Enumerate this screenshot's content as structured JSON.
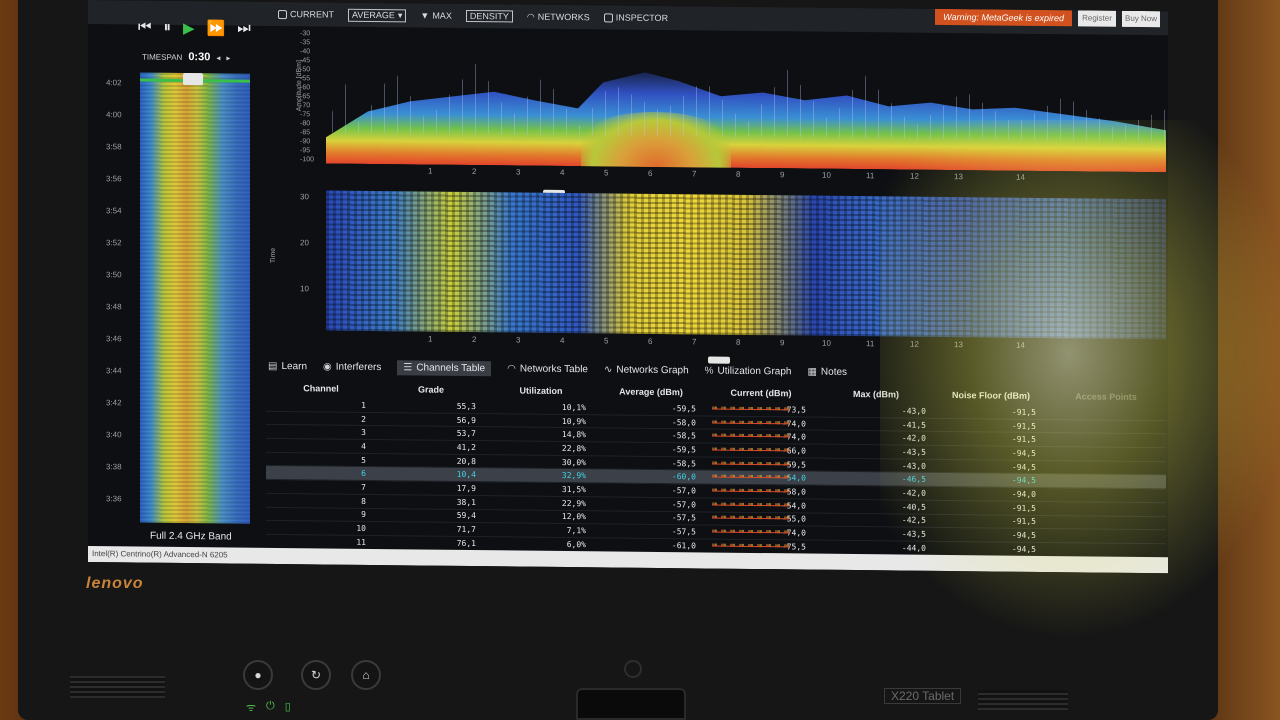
{
  "toolbar": {
    "current": "CURRENT",
    "average": "AVERAGE",
    "max": "MAX",
    "density": "DENSITY",
    "networks": "NETWORKS",
    "inspector": "INSPECTOR",
    "warning": "Warning: MetaGeek is expired",
    "register": "Register",
    "buy": "Buy Now"
  },
  "left_panel": {
    "timespan_label": "TIMESPAN",
    "timespan_value": "0:30",
    "time_ticks": [
      "4:02",
      "4:00",
      "3:58",
      "3:56",
      "3:54",
      "3:52",
      "3:50",
      "3:48",
      "3:46",
      "3:44",
      "3:42",
      "3:40",
      "3:38",
      "3:36"
    ],
    "band_label": "Full 2.4 GHz Band"
  },
  "spectrum": {
    "amplitude_title": "Amplitude [dBm]",
    "amplitude_ticks": [
      "-30",
      "-35",
      "-40",
      "-45",
      "-50",
      "-55",
      "-60",
      "-65",
      "-70",
      "-75",
      "-80",
      "-85",
      "-90",
      "-95",
      "-100"
    ],
    "channel_ticks": [
      "1",
      "2",
      "3",
      "4",
      "5",
      "6",
      "7",
      "8",
      "9",
      "10",
      "11",
      "12",
      "13",
      "14"
    ]
  },
  "density": {
    "time_title": "Time",
    "time_ticks": [
      "30",
      "20",
      "10"
    ],
    "channel_ticks": [
      "1",
      "2",
      "3",
      "4",
      "5",
      "6",
      "7",
      "8",
      "9",
      "10",
      "11",
      "12",
      "13",
      "14"
    ]
  },
  "tabs": {
    "learn": "Learn",
    "interferers": "Interferers",
    "channels_table": "Channels Table",
    "networks_table": "Networks Table",
    "networks_graph": "Networks Graph",
    "utilization_graph": "Utilization Graph",
    "notes": "Notes"
  },
  "table": {
    "headers": {
      "channel": "Channel",
      "grade": "Grade",
      "utilization": "Utilization",
      "average": "Average (dBm)",
      "current": "Current (dBm)",
      "max": "Max (dBm)",
      "noise_floor": "Noise Floor (dBm)",
      "access_points": "Access Points"
    },
    "rows": [
      {
        "channel": "1",
        "grade": "55,3",
        "utilization": "10,1%",
        "average": "-59,5",
        "current": "-73,5",
        "max": "-43,0",
        "noise": "-91,5"
      },
      {
        "channel": "2",
        "grade": "56,9",
        "utilization": "10,9%",
        "average": "-58,0",
        "current": "-74,0",
        "max": "-41,5",
        "noise": "-91,5"
      },
      {
        "channel": "3",
        "grade": "53,7",
        "utilization": "14,8%",
        "average": "-58,5",
        "current": "-74,0",
        "max": "-42,0",
        "noise": "-91,5"
      },
      {
        "channel": "4",
        "grade": "41,2",
        "utilization": "22,8%",
        "average": "-59,5",
        "current": "-66,0",
        "max": "-43,5",
        "noise": "-94,5"
      },
      {
        "channel": "5",
        "grade": "20,8",
        "utilization": "30,0%",
        "average": "-58,5",
        "current": "-59,5",
        "max": "-43,0",
        "noise": "-94,5"
      },
      {
        "channel": "6",
        "grade": "10,4",
        "utilization": "32,9%",
        "average": "-60,0",
        "current": "-54,0",
        "max": "-46,5",
        "noise": "-94,5"
      },
      {
        "channel": "7",
        "grade": "17,9",
        "utilization": "31,5%",
        "average": "-57,0",
        "current": "-58,0",
        "max": "-42,0",
        "noise": "-94,0"
      },
      {
        "channel": "8",
        "grade": "38,1",
        "utilization": "22,9%",
        "average": "-57,0",
        "current": "-54,0",
        "max": "-40,5",
        "noise": "-91,5"
      },
      {
        "channel": "9",
        "grade": "59,4",
        "utilization": "12,0%",
        "average": "-57,5",
        "current": "-55,0",
        "max": "-42,5",
        "noise": "-91,5"
      },
      {
        "channel": "10",
        "grade": "71,7",
        "utilization": "7,1%",
        "average": "-57,5",
        "current": "-74,0",
        "max": "-43,5",
        "noise": "-94,5"
      },
      {
        "channel": "11",
        "grade": "76,1",
        "utilization": "6,0%",
        "average": "-61,0",
        "current": "-75,5",
        "max": "-44,0",
        "noise": "-94,5"
      }
    ]
  },
  "statusbar": {
    "adapter": "Intel(R) Centrino(R) Advanced-N 6205"
  },
  "laptop": {
    "brand": "lenovo",
    "model": "X220 Tablet"
  }
}
